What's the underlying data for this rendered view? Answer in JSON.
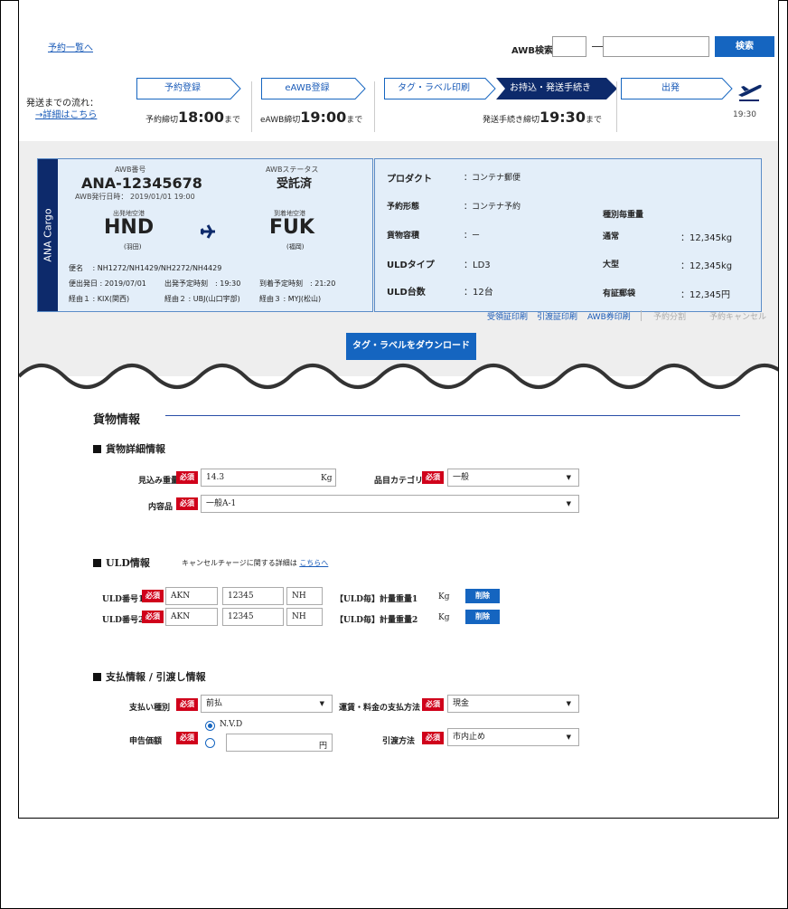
{
  "top": {
    "back_link": "予約一覧へ",
    "awb_search_label": "AWB検索",
    "awb_dash": "―",
    "search_button": "検索"
  },
  "flow": {
    "label": "発送までの流れ：",
    "detail_link": "→詳細はこちら",
    "steps": [
      {
        "label": "予約登録"
      },
      {
        "label": "eAWB登録"
      },
      {
        "label": "タグ・ラベル印刷"
      },
      {
        "label": "お持込・発送手続き"
      },
      {
        "label": "出発"
      }
    ],
    "deadlines": [
      {
        "prefix": "予約締切",
        "time": "18:00",
        "suffix": "まで"
      },
      {
        "prefix": "eAWB締切",
        "time": "19:00",
        "suffix": "まで"
      },
      {
        "prefix": "発送手続き締切",
        "time": "19:30",
        "suffix": "まで"
      }
    ],
    "departure_time": "19:30"
  },
  "card": {
    "side_label": "ANA Cargo",
    "awb_no_label": "AWB番号",
    "awb_no": "ANA-12345678",
    "issued": "AWB発行日時： 2019/01/01 19:00",
    "status_label": "AWBステータス",
    "status": "受託済",
    "origin_label": "出発地空港",
    "origin": "HND",
    "origin_name": "(羽田)",
    "dest_label": "到着地空港",
    "dest": "FUK",
    "dest_name": "(福岡)",
    "flight": "便名　 : NH1272/NH1429/NH2272/NH4429",
    "dep_date": "便出発日 : 2019/07/01",
    "dep_time": "出発予定時刻　: 19:30",
    "arr_time": "到着予定時刻　: 21:20",
    "via1": "経由１ : KIX(関西)",
    "via2": "経由２ : UBJ(山口宇部)",
    "via3": "経由３ : MYJ(松山)"
  },
  "info": {
    "rows": [
      {
        "label": "プロダクト",
        "value": "：コンテナ郵便"
      },
      {
        "label": "予約形態",
        "value": "：コンテナ予約"
      },
      {
        "label": "貨物容積",
        "value": "：ー"
      },
      {
        "label": "ULDタイプ",
        "value": "：LD3"
      },
      {
        "label": "ULD台数",
        "value": "：12台"
      }
    ],
    "weight_title": "種別毎重量",
    "weights": [
      {
        "label": "通常",
        "value": "：12,345kg"
      },
      {
        "label": "大型",
        "value": "：12,345kg"
      },
      {
        "label": "有証郵袋",
        "value": "：12,345円"
      }
    ]
  },
  "actions": {
    "receipt": "受領証印刷",
    "handover": "引渡証印刷",
    "awb_print": "AWB券印刷",
    "split": "予約分割",
    "cancel": "予約キャンセル"
  },
  "download_button": "タグ・ラベルをダウンロード",
  "form": {
    "title": "貨物情報",
    "required": "必須",
    "detail": {
      "title": "貨物詳細情報",
      "weight_label": "見込み重量",
      "weight_value": "14.3",
      "weight_unit": "Kg",
      "category_label": "品目カテゴリ",
      "category_value": "一般",
      "content_label": "内容品",
      "content_value": "一般A-1"
    },
    "uld": {
      "title": "ULD情報",
      "note_prefix": "キャンセルチャージに関する詳細は",
      "note_link": "こちらへ",
      "rows": [
        {
          "label": "ULD番号1",
          "type": "AKN",
          "num": "12345",
          "carrier": "NH",
          "weight_label": "【ULD毎】計量重量1",
          "unit": "Kg",
          "delete": "削除"
        },
        {
          "label": "ULD番号2",
          "type": "AKN",
          "num": "12345",
          "carrier": "NH",
          "weight_label": "【ULD毎】計量重量2",
          "unit": "Kg",
          "delete": "削除"
        }
      ]
    },
    "payment": {
      "title": "支払情報 / 引渡し情報",
      "pay_type_label": "支払い種別",
      "pay_type_value": "前払",
      "fee_method_label": "運賃・料金の支払方法",
      "fee_method_value": "現金",
      "declared_label": "申告価額",
      "nvd": "N.V.D",
      "yen": "円",
      "delivery_label": "引渡方法",
      "delivery_value": "市内止め"
    }
  }
}
